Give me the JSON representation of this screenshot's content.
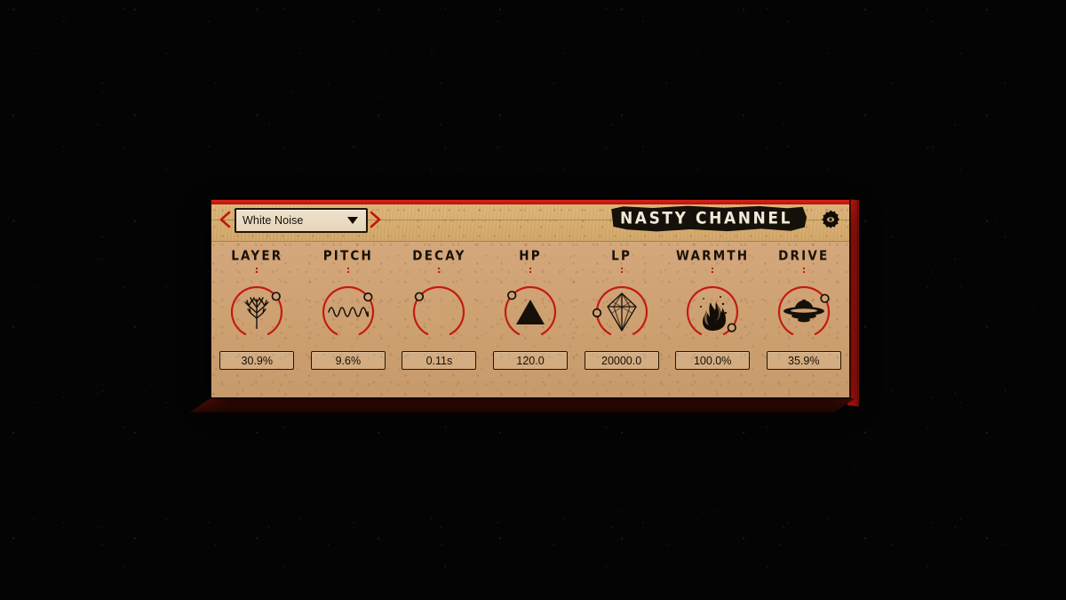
{
  "app": {
    "brand_title": "NASTY CHANNEL",
    "accent_red": "#c4150d",
    "panel_tan": "#cfa274",
    "header_tan": "#d8ae72",
    "ink_black": "#1a1108"
  },
  "header": {
    "prev_label": "‹",
    "next_label": "›",
    "preset_value": "White Noise",
    "preset_placeholder": "White Noise",
    "caret_icon": "chevron-down-icon",
    "gear_icon": "gear-eye-icon",
    "prev_icon": "chevron-left-icon",
    "next_icon": "chevron-right-icon"
  },
  "knobs": [
    {
      "id": "layer",
      "label": "LAYER",
      "value": "30.9%",
      "icon": "tree-icon",
      "angle_deg": 51,
      "arc_sweep_deg": 51
    },
    {
      "id": "pitch",
      "label": "PITCH",
      "value": "9.6%",
      "icon": "sine-wave-icon",
      "angle_deg": 53,
      "arc_sweep_deg": 53
    },
    {
      "id": "decay",
      "label": "DECAY",
      "value": "0.11s",
      "icon": "crescent-moon-icon",
      "angle_deg": -52,
      "arc_sweep_deg": -52
    },
    {
      "id": "hp",
      "label": "HP",
      "value": "120.0",
      "icon": "triangle-icon",
      "angle_deg": -48,
      "arc_sweep_deg": -48
    },
    {
      "id": "lp",
      "label": "LP",
      "value": "20000.0",
      "icon": "crystal-octahedron-icon",
      "angle_deg": -92,
      "arc_sweep_deg": -92
    },
    {
      "id": "warmth",
      "label": "WARMTH",
      "value": "100.0%",
      "icon": "flame-icon",
      "angle_deg": 129,
      "arc_sweep_deg": 129
    },
    {
      "id": "drive",
      "label": "DRIVE",
      "value": "35.9%",
      "icon": "ufo-icon",
      "angle_deg": 57,
      "arc_sweep_deg": 57
    }
  ]
}
